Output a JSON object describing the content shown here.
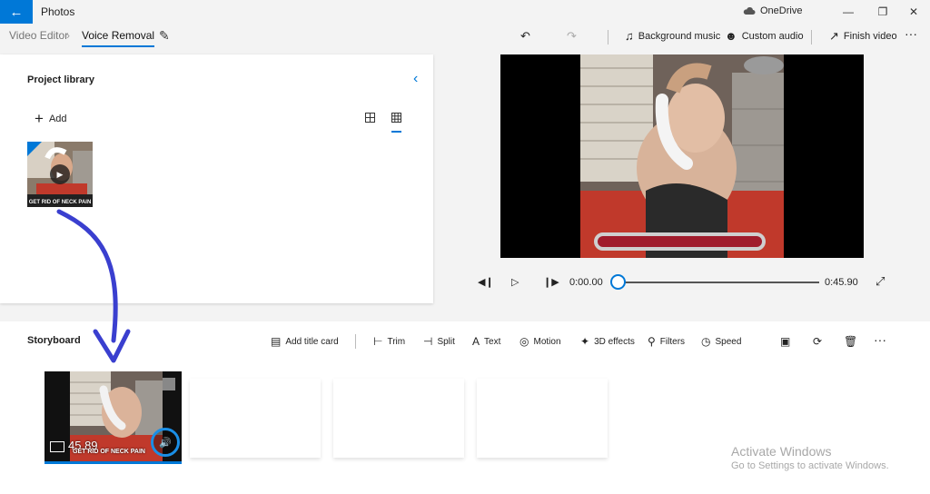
{
  "window": {
    "back_icon": "back-arrow-icon",
    "app_title": "Photos",
    "onedrive_label": "OneDrive",
    "onedrive_icon": "cloud-icon",
    "buttons": [
      "minimize",
      "maximize",
      "close"
    ]
  },
  "toolbar": {
    "breadcrumb_root": "Video Editor",
    "breadcrumb_current": "Voice Removal",
    "undo_icon": "undo-icon",
    "redo_icon": "redo-icon",
    "background_music": "Background music",
    "custom_audio": "Custom audio",
    "finish_video": "Finish video",
    "more": "···"
  },
  "library": {
    "title": "Project library",
    "add_label": "Add",
    "thumb_caption": "GET RID OF NECK PAIN"
  },
  "player": {
    "current_time": "0:00.00",
    "total_time": "0:45.90",
    "progress": 0
  },
  "storyboard": {
    "title": "Storyboard",
    "tools": {
      "add_title_card": "Add title card",
      "trim": "Trim",
      "split": "Split",
      "text": "Text",
      "motion": "Motion",
      "effects_3d": "3D effects",
      "filters": "Filters",
      "speed": "Speed"
    },
    "clip": {
      "duration": "45.89",
      "caption": "GET RID OF NECK PAIN",
      "volume_icon": "volume-icon"
    }
  },
  "watermark": {
    "line1": "Activate Windows",
    "line2": "Go to Settings to activate Windows."
  },
  "colors": {
    "accent": "#0078d7",
    "annotation_arrow": "#3a3fcf",
    "annotation_circle": "#1a8ee6"
  }
}
